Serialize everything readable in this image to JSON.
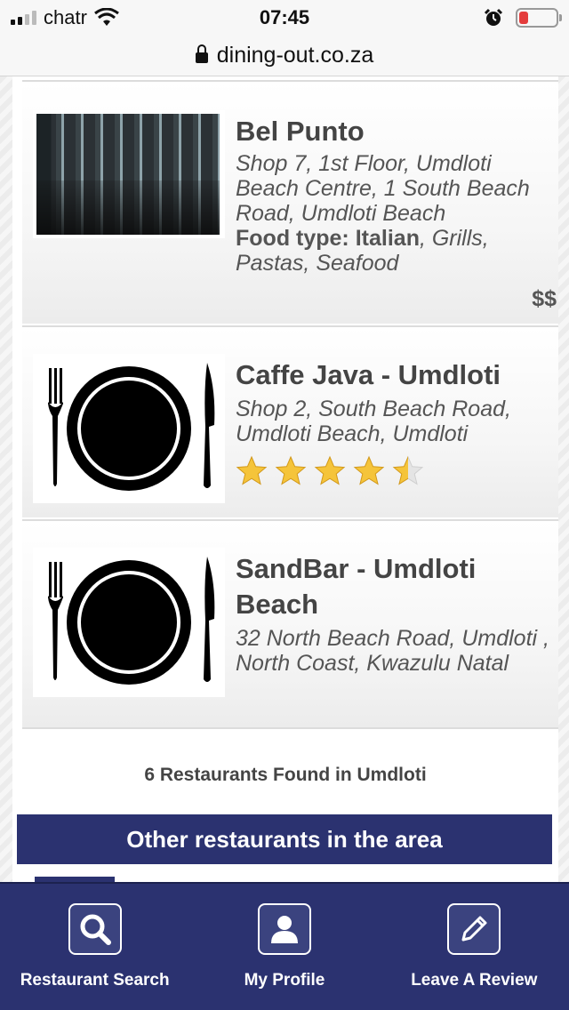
{
  "status_bar": {
    "carrier": "chatr",
    "time": "07:45"
  },
  "browser": {
    "url": "dining-out.co.za"
  },
  "restaurants": [
    {
      "name": "Bel Punto",
      "address": "Shop 7, 1st Floor, Umdloti Beach Centre, 1 South Beach Road, Umdloti Beach",
      "food_type_label": "Food type:",
      "food_type_primary": "Italian",
      "food_type_rest": ", Grills, Pastas, Seafood",
      "price": "$$"
    },
    {
      "name": "Caffe Java - Umdloti",
      "address": "Shop 2, South Beach Road, Umdloti Beach, Umdloti",
      "rating": 4.5,
      "rating_max": 5
    },
    {
      "name": "SandBar - Umdloti Beach",
      "address": "32 North Beach Road, Umdloti , North Coast, Kwazulu Natal"
    }
  ],
  "results_count_text": "6 Restaurants Found in Umdloti",
  "other_restaurants_label": "Other restaurants in the area",
  "bottom_nav": [
    {
      "label": "Restaurant Search",
      "icon": "search-icon"
    },
    {
      "label": "My Profile",
      "icon": "profile-icon"
    },
    {
      "label": "Leave A Review",
      "icon": "pencil-icon"
    }
  ],
  "colors": {
    "brand_navy": "#2b3270",
    "star_gold": "#f5c43a",
    "battery_low": "#e43c3c"
  }
}
